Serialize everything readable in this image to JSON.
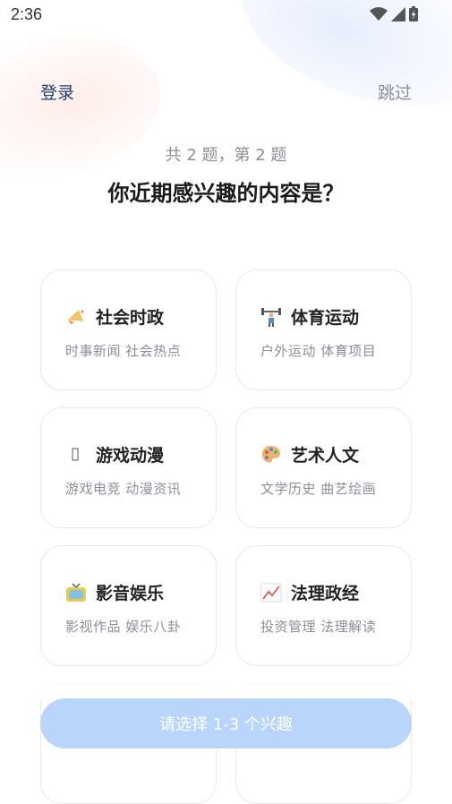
{
  "status_bar": {
    "time": "2:36"
  },
  "nav": {
    "login": "登录",
    "skip": "跳过"
  },
  "quiz": {
    "step": "共 2 题，第 2 题",
    "title": "你近期感兴趣的内容是？"
  },
  "categories": [
    {
      "title": "社会时政",
      "subtitle": "时事新闻 社会热点",
      "icon": "megaphone-icon"
    },
    {
      "title": "体育运动",
      "subtitle": "户外运动 体育项目",
      "icon": "weightlifter-icon"
    },
    {
      "title": "游戏动漫",
      "subtitle": "游戏电竞 动漫资讯",
      "icon": "game-icon"
    },
    {
      "title": "艺术人文",
      "subtitle": "文学历史 曲艺绘画",
      "icon": "palette-icon"
    },
    {
      "title": "影音娱乐",
      "subtitle": "影视作品 娱乐八卦",
      "icon": "tv-icon"
    },
    {
      "title": "法理政经",
      "subtitle": "投资管理 法理解读",
      "icon": "chart-icon"
    }
  ],
  "cta": {
    "label": "请选择 1-3 个兴趣"
  },
  "colors": {
    "brand": "#1d3f7a",
    "cta_disabled": "#b9d5fb",
    "muted": "#8a8f99"
  }
}
